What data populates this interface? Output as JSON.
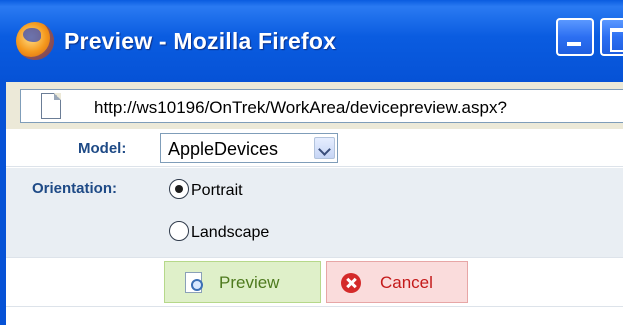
{
  "window": {
    "title": "Preview - Mozilla Firefox",
    "icon": "firefox-icon",
    "controls": [
      "minimize-icon",
      "maximize-icon"
    ]
  },
  "address_bar": {
    "url": "http://ws10196/OnTrek/WorkArea/devicepreview.aspx?",
    "icon": "page-icon"
  },
  "form": {
    "model": {
      "label": "Model:",
      "selected": "AppleDevices"
    },
    "orientation": {
      "label": "Orientation:",
      "options": [
        {
          "label": "Portrait",
          "checked": true
        },
        {
          "label": "Landscape",
          "checked": false
        }
      ]
    },
    "buttons": {
      "preview": {
        "label": "Preview",
        "icon": "preview-icon",
        "color": "#dff0c9"
      },
      "cancel": {
        "label": "Cancel",
        "icon": "cancel-icon",
        "color": "#fadcdc"
      }
    }
  },
  "colors": {
    "titlebar": "#0a5ce0",
    "label_text": "#1e4a86",
    "orientation_row_bg": "#e9eef3"
  }
}
